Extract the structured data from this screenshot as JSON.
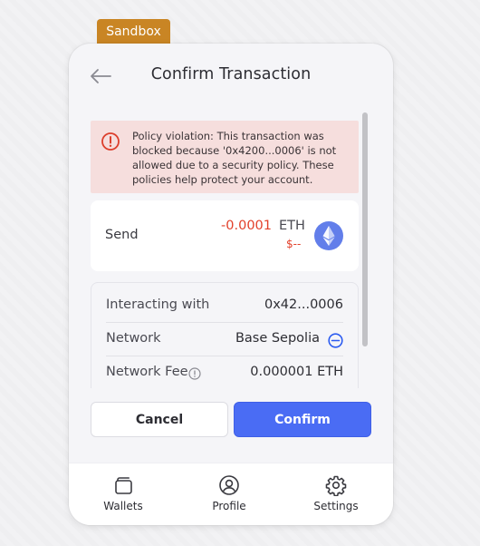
{
  "badge": {
    "label": "Sandbox",
    "color": "#c98524"
  },
  "header": {
    "title": "Confirm Transaction",
    "back_icon": "arrow-left-icon"
  },
  "alert": {
    "icon": "error-circle-icon",
    "message": "Policy violation: This transaction was blocked because '0x4200...0006' is not allowed due to a security policy. These policies help protect your account.",
    "background_color": "#f6dedd"
  },
  "send": {
    "label": "Send",
    "amount": "-0.0001",
    "unit": "ETH",
    "usd_value": "$--",
    "token_icon": "ethereum-icon",
    "amount_color": "#e2402a"
  },
  "details": [
    {
      "label": "Interacting with",
      "value": "0x42...0006"
    },
    {
      "label": "Network",
      "value": "Base Sepolia",
      "icon": "base-network-icon"
    },
    {
      "label": "Network Fee",
      "value": "0.000001 ETH",
      "icon": "info-icon"
    }
  ],
  "actions": {
    "cancel_label": "Cancel",
    "confirm_label": "Confirm",
    "accent_color": "#4a6cf4"
  },
  "nav": [
    {
      "label": "Wallets",
      "icon": "wallet-icon"
    },
    {
      "label": "Profile",
      "icon": "profile-icon"
    },
    {
      "label": "Settings",
      "icon": "gear-icon"
    }
  ]
}
